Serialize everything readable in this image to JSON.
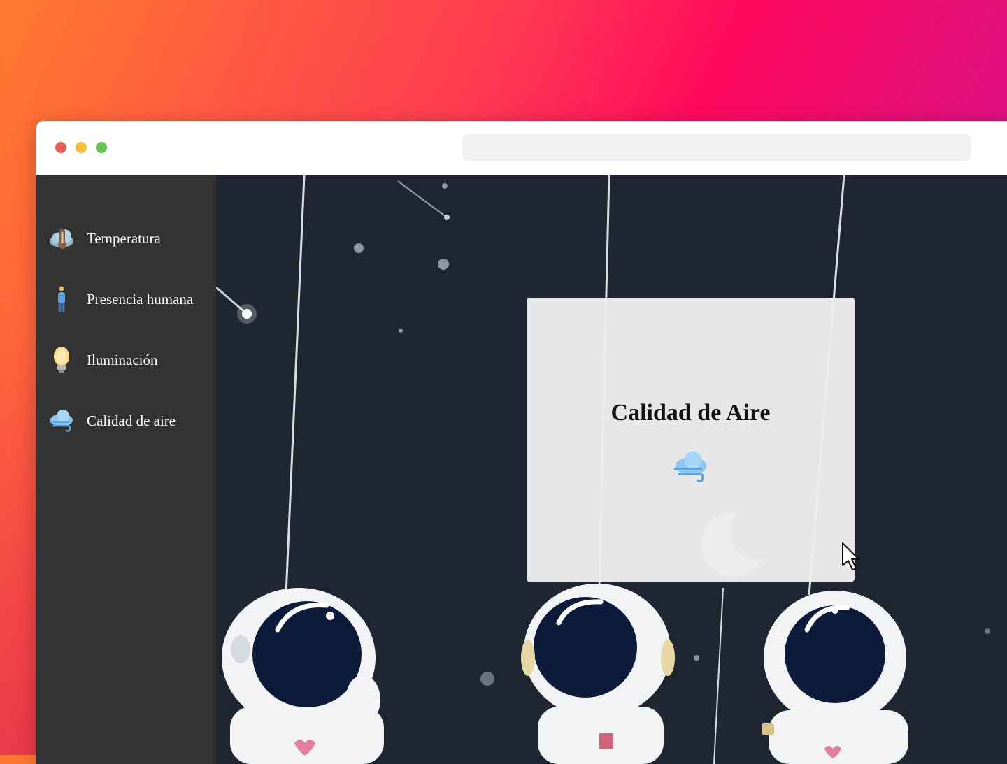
{
  "sidebar": {
    "items": [
      {
        "label": "Temperatura",
        "icon": "thermometer-cloud-icon"
      },
      {
        "label": "Presencia humana",
        "icon": "person-icon"
      },
      {
        "label": "Iluminación",
        "icon": "lightbulb-icon"
      },
      {
        "label": "Calidad de aire",
        "icon": "cloud-wind-icon"
      }
    ]
  },
  "card": {
    "title": "Calidad de Aire",
    "icon": "cloud-wind-icon"
  },
  "colors": {
    "sidebar_bg": "#333333",
    "content_bg": "#1f2631",
    "card_bg": "#eceedf",
    "window_controls": [
      "#ec5f57",
      "#f5bd3b",
      "#5fc54a"
    ]
  }
}
